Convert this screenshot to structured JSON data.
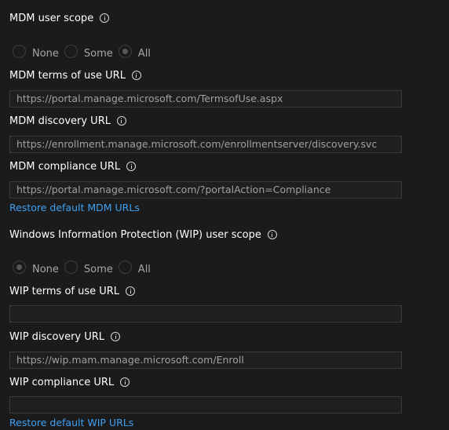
{
  "mdm": {
    "scope_label": "MDM user scope",
    "scope_options": [
      "None",
      "Some",
      "All"
    ],
    "scope_selected": "All",
    "terms_label": "MDM terms of use URL",
    "terms_value": "https://portal.manage.microsoft.com/TermsofUse.aspx",
    "discovery_label": "MDM discovery URL",
    "discovery_value": "https://enrollment.manage.microsoft.com/enrollmentserver/discovery.svc",
    "compliance_label": "MDM compliance URL",
    "compliance_value": "https://portal.manage.microsoft.com/?portalAction=Compliance",
    "restore_link": "Restore default MDM URLs"
  },
  "wip": {
    "scope_label": "Windows Information Protection (WIP) user scope",
    "scope_options": [
      "None",
      "Some",
      "All"
    ],
    "scope_selected": "None",
    "terms_label": "WIP terms of use URL",
    "terms_value": "",
    "discovery_label": "WIP discovery URL",
    "discovery_value": "https://wip.mam.manage.microsoft.com/Enroll",
    "compliance_label": "WIP compliance URL",
    "compliance_value": "",
    "restore_link": "Restore default WIP URLs"
  },
  "icons": {
    "info": "info-icon"
  },
  "colors": {
    "background": "#1b1b1c",
    "link": "#3ea0f2",
    "field_border": "#3b3b3d",
    "field_text": "#a0a0a0"
  }
}
